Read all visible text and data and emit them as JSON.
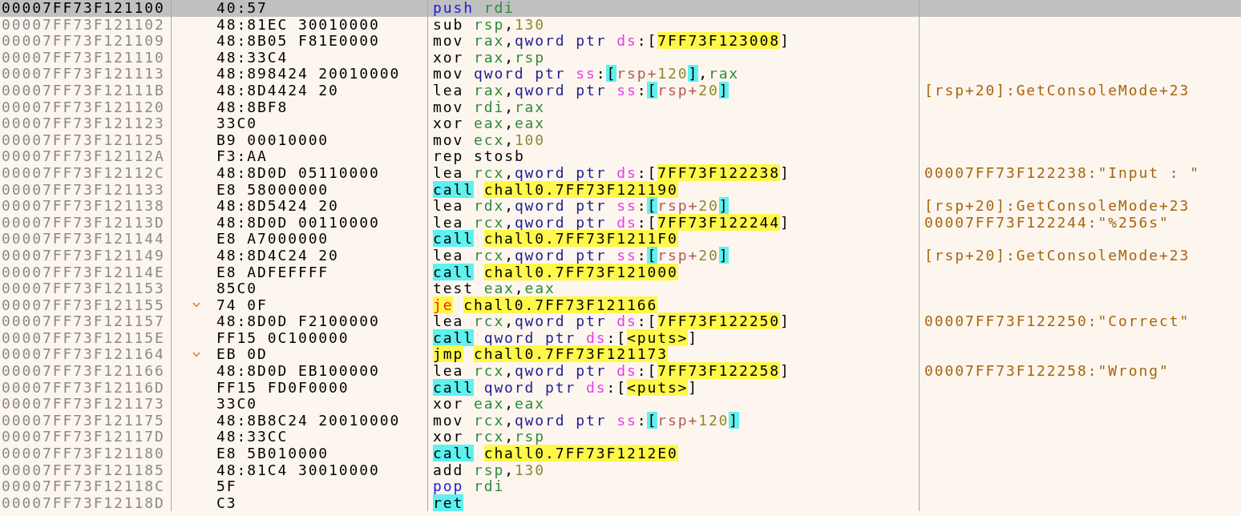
{
  "rows": [
    {
      "address": "00007FF73F121100",
      "bytes": "40:57",
      "selected": true,
      "branch": false,
      "tokens": [
        {
          "text": "push",
          "kind": "op2"
        },
        {
          "text": "rdi",
          "kind": "reg"
        }
      ]
    },
    {
      "address": "00007FF73F121102",
      "bytes": "48:81EC 30010000",
      "selected": false,
      "branch": false,
      "tokens": [
        {
          "text": "sub",
          "kind": "op"
        },
        {
          "text": "rsp",
          "kind": "reg"
        },
        {
          "text": ",",
          "kind": "p"
        },
        {
          "text": "130",
          "kind": "imm"
        }
      ]
    },
    {
      "address": "00007FF73F121109",
      "bytes": "48:8B05 F81E0000",
      "selected": false,
      "branch": false,
      "tokens": [
        {
          "text": "mov",
          "kind": "op"
        },
        {
          "text": "rax",
          "kind": "reg"
        },
        {
          "text": ",",
          "kind": "p"
        },
        {
          "text": "qword ptr",
          "kind": "size"
        },
        {
          "text": "ds",
          "kind": "seg"
        },
        {
          "text": ":[",
          "kind": "p"
        },
        {
          "text": "7FF73F123008",
          "kind": "addr"
        },
        {
          "text": "]",
          "kind": "p"
        }
      ]
    },
    {
      "address": "00007FF73F121110",
      "bytes": "48:33C4",
      "selected": false,
      "branch": false,
      "tokens": [
        {
          "text": "xor",
          "kind": "op"
        },
        {
          "text": "rax",
          "kind": "reg"
        },
        {
          "text": ",",
          "kind": "p"
        },
        {
          "text": "rsp",
          "kind": "reg"
        }
      ]
    },
    {
      "address": "00007FF73F121113",
      "bytes": "48:898424 20010000",
      "selected": false,
      "branch": false,
      "tokens": [
        {
          "text": "mov",
          "kind": "op"
        },
        {
          "text": "qword ptr",
          "kind": "size"
        },
        {
          "text": "ss",
          "kind": "seg"
        },
        {
          "text": ":",
          "kind": "p"
        },
        {
          "text": "[",
          "kind": "br"
        },
        {
          "text": "rsp+",
          "kind": "sreg"
        },
        {
          "text": "120",
          "kind": "simm"
        },
        {
          "text": "]",
          "kind": "br"
        },
        {
          "text": ",",
          "kind": "p"
        },
        {
          "text": "rax",
          "kind": "reg"
        }
      ]
    },
    {
      "address": "00007FF73F12111B",
      "bytes": "48:8D4424 20",
      "selected": false,
      "branch": false,
      "tokens": [
        {
          "text": "lea",
          "kind": "op"
        },
        {
          "text": "rax",
          "kind": "reg"
        },
        {
          "text": ",",
          "kind": "p"
        },
        {
          "text": "qword ptr",
          "kind": "size"
        },
        {
          "text": "ss",
          "kind": "seg"
        },
        {
          "text": ":",
          "kind": "p"
        },
        {
          "text": "[",
          "kind": "br"
        },
        {
          "text": "rsp+",
          "kind": "sreg"
        },
        {
          "text": "20",
          "kind": "simm"
        },
        {
          "text": "]",
          "kind": "br"
        }
      ],
      "comment": "[rsp+20]:GetConsoleMode+23"
    },
    {
      "address": "00007FF73F121120",
      "bytes": "48:8BF8",
      "selected": false,
      "branch": false,
      "tokens": [
        {
          "text": "mov",
          "kind": "op"
        },
        {
          "text": "rdi",
          "kind": "reg"
        },
        {
          "text": ",",
          "kind": "p"
        },
        {
          "text": "rax",
          "kind": "reg"
        }
      ]
    },
    {
      "address": "00007FF73F121123",
      "bytes": "33C0",
      "selected": false,
      "branch": false,
      "tokens": [
        {
          "text": "xor",
          "kind": "op"
        },
        {
          "text": "eax",
          "kind": "reg"
        },
        {
          "text": ",",
          "kind": "p"
        },
        {
          "text": "eax",
          "kind": "reg"
        }
      ]
    },
    {
      "address": "00007FF73F121125",
      "bytes": "B9 00010000",
      "selected": false,
      "branch": false,
      "tokens": [
        {
          "text": "mov",
          "kind": "op"
        },
        {
          "text": "ecx",
          "kind": "reg"
        },
        {
          "text": ",",
          "kind": "p"
        },
        {
          "text": "100",
          "kind": "imm"
        }
      ]
    },
    {
      "address": "00007FF73F12112A",
      "bytes": "F3:AA",
      "selected": false,
      "branch": false,
      "tokens": [
        {
          "text": "rep stosb",
          "kind": "op"
        }
      ]
    },
    {
      "address": "00007FF73F12112C",
      "bytes": "48:8D0D 05110000",
      "selected": false,
      "branch": false,
      "tokens": [
        {
          "text": "lea",
          "kind": "op"
        },
        {
          "text": "rcx",
          "kind": "reg"
        },
        {
          "text": ",",
          "kind": "p"
        },
        {
          "text": "qword ptr",
          "kind": "size"
        },
        {
          "text": "ds",
          "kind": "seg"
        },
        {
          "text": ":[",
          "kind": "p"
        },
        {
          "text": "7FF73F122238",
          "kind": "addr"
        },
        {
          "text": "]",
          "kind": "p"
        }
      ],
      "comment": "00007FF73F122238:\"Input : \""
    },
    {
      "address": "00007FF73F121133",
      "bytes": "E8 58000000",
      "selected": false,
      "branch": false,
      "tokens": [
        {
          "text": "call",
          "kind": "call"
        },
        {
          "text": "chall0.7FF73F121190",
          "kind": "addr"
        }
      ]
    },
    {
      "address": "00007FF73F121138",
      "bytes": "48:8D5424 20",
      "selected": false,
      "branch": false,
      "tokens": [
        {
          "text": "lea",
          "kind": "op"
        },
        {
          "text": "rdx",
          "kind": "reg"
        },
        {
          "text": ",",
          "kind": "p"
        },
        {
          "text": "qword ptr",
          "kind": "size"
        },
        {
          "text": "ss",
          "kind": "seg"
        },
        {
          "text": ":",
          "kind": "p"
        },
        {
          "text": "[",
          "kind": "br"
        },
        {
          "text": "rsp+",
          "kind": "sreg"
        },
        {
          "text": "20",
          "kind": "simm"
        },
        {
          "text": "]",
          "kind": "br"
        }
      ],
      "comment": "[rsp+20]:GetConsoleMode+23"
    },
    {
      "address": "00007FF73F12113D",
      "bytes": "48:8D0D 00110000",
      "selected": false,
      "branch": false,
      "tokens": [
        {
          "text": "lea",
          "kind": "op"
        },
        {
          "text": "rcx",
          "kind": "reg"
        },
        {
          "text": ",",
          "kind": "p"
        },
        {
          "text": "qword ptr",
          "kind": "size"
        },
        {
          "text": "ds",
          "kind": "seg"
        },
        {
          "text": ":[",
          "kind": "p"
        },
        {
          "text": "7FF73F122244",
          "kind": "addr"
        },
        {
          "text": "]",
          "kind": "p"
        }
      ],
      "comment": "00007FF73F122244:\"%256s\""
    },
    {
      "address": "00007FF73F121144",
      "bytes": "E8 A7000000",
      "selected": false,
      "branch": false,
      "tokens": [
        {
          "text": "call",
          "kind": "call"
        },
        {
          "text": "chall0.7FF73F1211F0",
          "kind": "addr"
        }
      ]
    },
    {
      "address": "00007FF73F121149",
      "bytes": "48:8D4C24 20",
      "selected": false,
      "branch": false,
      "tokens": [
        {
          "text": "lea",
          "kind": "op"
        },
        {
          "text": "rcx",
          "kind": "reg"
        },
        {
          "text": ",",
          "kind": "p"
        },
        {
          "text": "qword ptr",
          "kind": "size"
        },
        {
          "text": "ss",
          "kind": "seg"
        },
        {
          "text": ":",
          "kind": "p"
        },
        {
          "text": "[",
          "kind": "br"
        },
        {
          "text": "rsp+",
          "kind": "sreg"
        },
        {
          "text": "20",
          "kind": "simm"
        },
        {
          "text": "]",
          "kind": "br"
        }
      ],
      "comment": "[rsp+20]:GetConsoleMode+23"
    },
    {
      "address": "00007FF73F12114E",
      "bytes": "E8 ADFEFFFF",
      "selected": false,
      "branch": false,
      "tokens": [
        {
          "text": "call",
          "kind": "call"
        },
        {
          "text": "chall0.7FF73F121000",
          "kind": "addr"
        }
      ]
    },
    {
      "address": "00007FF73F121153",
      "bytes": "85C0",
      "selected": false,
      "branch": false,
      "tokens": [
        {
          "text": "test",
          "kind": "op"
        },
        {
          "text": "eax",
          "kind": "reg"
        },
        {
          "text": ",",
          "kind": "p"
        },
        {
          "text": "eax",
          "kind": "reg"
        }
      ]
    },
    {
      "address": "00007FF73F121155",
      "bytes": "74 0F",
      "selected": false,
      "branch": true,
      "tokens": [
        {
          "text": "je",
          "kind": "jcc"
        },
        {
          "text": "chall0.7FF73F121166",
          "kind": "addr"
        }
      ]
    },
    {
      "address": "00007FF73F121157",
      "bytes": "48:8D0D F2100000",
      "selected": false,
      "branch": false,
      "tokens": [
        {
          "text": "lea",
          "kind": "op"
        },
        {
          "text": "rcx",
          "kind": "reg"
        },
        {
          "text": ",",
          "kind": "p"
        },
        {
          "text": "qword ptr",
          "kind": "size"
        },
        {
          "text": "ds",
          "kind": "seg"
        },
        {
          "text": ":[",
          "kind": "p"
        },
        {
          "text": "7FF73F122250",
          "kind": "addr"
        },
        {
          "text": "]",
          "kind": "p"
        }
      ],
      "comment": "00007FF73F122250:\"Correct\""
    },
    {
      "address": "00007FF73F12115E",
      "bytes": "FF15 0C100000",
      "selected": false,
      "branch": false,
      "tokens": [
        {
          "text": "call",
          "kind": "call"
        },
        {
          "text": "qword ptr",
          "kind": "size"
        },
        {
          "text": "ds",
          "kind": "seg"
        },
        {
          "text": ":[",
          "kind": "p"
        },
        {
          "text": "<puts>",
          "kind": "addr"
        },
        {
          "text": "]",
          "kind": "p"
        }
      ]
    },
    {
      "address": "00007FF73F121164",
      "bytes": "EB 0D",
      "selected": false,
      "branch": true,
      "tokens": [
        {
          "text": "jmp",
          "kind": "jmp"
        },
        {
          "text": "chall0.7FF73F121173",
          "kind": "addr"
        }
      ]
    },
    {
      "address": "00007FF73F121166",
      "bytes": "48:8D0D EB100000",
      "selected": false,
      "branch": false,
      "tokens": [
        {
          "text": "lea",
          "kind": "op"
        },
        {
          "text": "rcx",
          "kind": "reg"
        },
        {
          "text": ",",
          "kind": "p"
        },
        {
          "text": "qword ptr",
          "kind": "size"
        },
        {
          "text": "ds",
          "kind": "seg"
        },
        {
          "text": ":[",
          "kind": "p"
        },
        {
          "text": "7FF73F122258",
          "kind": "addr"
        },
        {
          "text": "]",
          "kind": "p"
        }
      ],
      "comment": "00007FF73F122258:\"Wrong\""
    },
    {
      "address": "00007FF73F12116D",
      "bytes": "FF15 FD0F0000",
      "selected": false,
      "branch": false,
      "tokens": [
        {
          "text": "call",
          "kind": "call"
        },
        {
          "text": "qword ptr",
          "kind": "size"
        },
        {
          "text": "ds",
          "kind": "seg"
        },
        {
          "text": ":[",
          "kind": "p"
        },
        {
          "text": "<puts>",
          "kind": "addr"
        },
        {
          "text": "]",
          "kind": "p"
        }
      ]
    },
    {
      "address": "00007FF73F121173",
      "bytes": "33C0",
      "selected": false,
      "branch": false,
      "tokens": [
        {
          "text": "xor",
          "kind": "op"
        },
        {
          "text": "eax",
          "kind": "reg"
        },
        {
          "text": ",",
          "kind": "p"
        },
        {
          "text": "eax",
          "kind": "reg"
        }
      ]
    },
    {
      "address": "00007FF73F121175",
      "bytes": "48:8B8C24 20010000",
      "selected": false,
      "branch": false,
      "tokens": [
        {
          "text": "mov",
          "kind": "op"
        },
        {
          "text": "rcx",
          "kind": "reg"
        },
        {
          "text": ",",
          "kind": "p"
        },
        {
          "text": "qword ptr",
          "kind": "size"
        },
        {
          "text": "ss",
          "kind": "seg"
        },
        {
          "text": ":",
          "kind": "p"
        },
        {
          "text": "[",
          "kind": "br"
        },
        {
          "text": "rsp+",
          "kind": "sreg"
        },
        {
          "text": "120",
          "kind": "simm"
        },
        {
          "text": "]",
          "kind": "br"
        }
      ]
    },
    {
      "address": "00007FF73F12117D",
      "bytes": "48:33CC",
      "selected": false,
      "branch": false,
      "tokens": [
        {
          "text": "xor",
          "kind": "op"
        },
        {
          "text": "rcx",
          "kind": "reg"
        },
        {
          "text": ",",
          "kind": "p"
        },
        {
          "text": "rsp",
          "kind": "reg"
        }
      ]
    },
    {
      "address": "00007FF73F121180",
      "bytes": "E8 5B010000",
      "selected": false,
      "branch": false,
      "tokens": [
        {
          "text": "call",
          "kind": "call"
        },
        {
          "text": "chall0.7FF73F1212E0",
          "kind": "addr"
        }
      ]
    },
    {
      "address": "00007FF73F121185",
      "bytes": "48:81C4 30010000",
      "selected": false,
      "branch": false,
      "tokens": [
        {
          "text": "add",
          "kind": "op"
        },
        {
          "text": "rsp",
          "kind": "reg"
        },
        {
          "text": ",",
          "kind": "p"
        },
        {
          "text": "130",
          "kind": "imm"
        }
      ]
    },
    {
      "address": "00007FF73F12118C",
      "bytes": "5F",
      "selected": false,
      "branch": false,
      "tokens": [
        {
          "text": "pop",
          "kind": "op2"
        },
        {
          "text": "rdi",
          "kind": "reg"
        }
      ]
    },
    {
      "address": "00007FF73F12118D",
      "bytes": "C3",
      "selected": false,
      "branch": false,
      "tokens": [
        {
          "text": "ret",
          "kind": "call"
        }
      ]
    }
  ]
}
